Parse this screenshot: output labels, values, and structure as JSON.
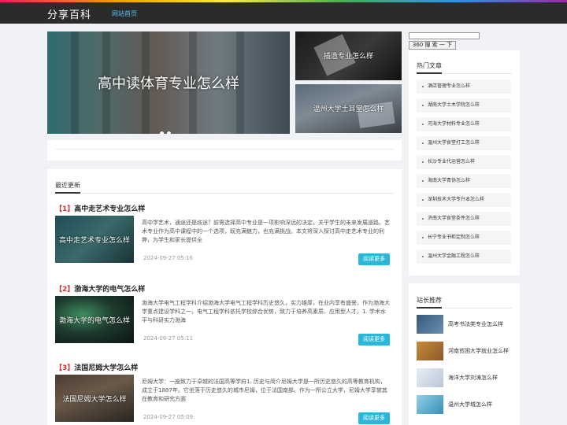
{
  "header": {
    "logo": "分享百科",
    "nav_link": "网站首页"
  },
  "banner": {
    "title": "高中读体育专业怎么样",
    "slide_count": 2
  },
  "side_cards": [
    {
      "label": "插造专业怎么样"
    },
    {
      "label": "温州大学土耳堂怎么样"
    }
  ],
  "search": {
    "placeholder": "",
    "button_label": "360 搜 索 一 下"
  },
  "recent": {
    "title": "最近更新",
    "articles": [
      {
        "num": "【1】",
        "title": "高中走艺术专业怎么样",
        "thumb_label": "高中走艺术专业怎么样",
        "summary": "高中学艺术，通途还是歧途？前需选择高中专业是一项影响深远的决定，关乎学生的未来发展道路。艺术专业作为高中课程中的一个选项，既充满魅力，也充满挑战。本文将深入探讨高中走艺术专业的利弊，为学生和家长提供全",
        "date": "2024-09-27 05:16",
        "more": "阅读更多"
      },
      {
        "num": "【2】",
        "title": "渤海大学的电气怎么样",
        "thumb_label": "渤海大学的电气怎么样",
        "summary": "渤海大学电气工程学科介绍渤海大学电气工程学科历史悠久，实力雄厚，在业内享有盛誉。作为渤海大学重点建设学科之一，电气工程学科依托学校综合优势，致力于培养高素质、应用型人才。1. 学术水平与科研实力渤海",
        "date": "2024-09-27 05:11",
        "more": "阅读更多"
      },
      {
        "num": "【3】",
        "title": "法国尼姆大学怎么样",
        "thumb_label": "法国尼姆大学怎么样",
        "summary": "尼姆大学：一座致力于卓越的法国高等学府1. 历史与简介尼姆大学是一所历史悠久的高等教育机构，成立于1887年。它坐落于历史悠久的城市尼姆，位于法国南部。作为一所公立大学，尼姆大学享誉其在教育和研究方面",
        "date": "2024-09-27 05:09",
        "more": "阅读更多"
      }
    ]
  },
  "hot": {
    "title": "热门文章",
    "items": [
      "酒店管理专业怎么样",
      "湖南大学土木学院怎么样",
      "河海大学材料专业怎么样",
      "温州大学食堂打工怎么样",
      "长沙专业代运营怎么样",
      "海南大学青协怎么样",
      "深圳技术大学专升本怎么样",
      "济南大学食堂条件怎么样",
      "长宁专业书柜定制怎么样",
      "温州大学金融工程怎么样"
    ]
  },
  "recommend": {
    "title": "站长推荐",
    "items": [
      "高考书法类专业怎么样",
      "河南贫困大学就业怎么样",
      "海洋大学刘涛怎么样",
      "温州大学城怎么样"
    ]
  }
}
